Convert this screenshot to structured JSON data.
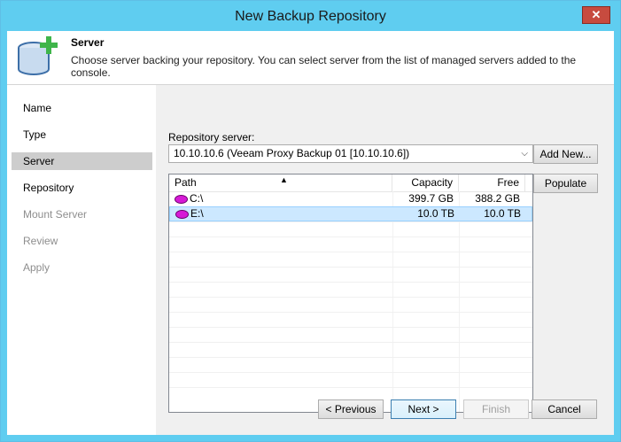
{
  "window": {
    "title": "New Backup Repository"
  },
  "header": {
    "title": "Server",
    "description": "Choose server backing your repository. You can select server from the list of managed servers added to the console."
  },
  "nav": {
    "items": [
      {
        "label": "Name",
        "state": "normal"
      },
      {
        "label": "Type",
        "state": "normal"
      },
      {
        "label": "Server",
        "state": "active"
      },
      {
        "label": "Repository",
        "state": "normal"
      },
      {
        "label": "Mount Server",
        "state": "disabled"
      },
      {
        "label": "Review",
        "state": "disabled"
      },
      {
        "label": "Apply",
        "state": "disabled"
      }
    ]
  },
  "form": {
    "server_label": "Repository server:",
    "server_value": "10.10.10.6 (Veeam Proxy Backup 01 [10.10.10.6])",
    "add_new_label": "Add New...",
    "populate_label": "Populate"
  },
  "table": {
    "columns": [
      "Path",
      "Capacity",
      "Free"
    ],
    "rows": [
      {
        "path": "C:\\",
        "capacity": "399.7 GB",
        "free": "388.2 GB",
        "selected": false
      },
      {
        "path": "E:\\",
        "capacity": "10.0 TB",
        "free": "10.0 TB",
        "selected": true
      }
    ]
  },
  "footer": {
    "previous_label": "< Previous",
    "next_label": "Next >",
    "finish_label": "Finish",
    "cancel_label": "Cancel"
  },
  "colors": {
    "titlebar": "#5fcdf0",
    "close": "#c74b3f",
    "selection": "#cce8ff",
    "disk_icon": "#d61ad6"
  },
  "icons": {
    "close": "close-icon",
    "header": "database-add-icon",
    "dropdown": "chevron-down-icon",
    "sort": "sort-ascending-icon",
    "disk": "disk-icon"
  }
}
